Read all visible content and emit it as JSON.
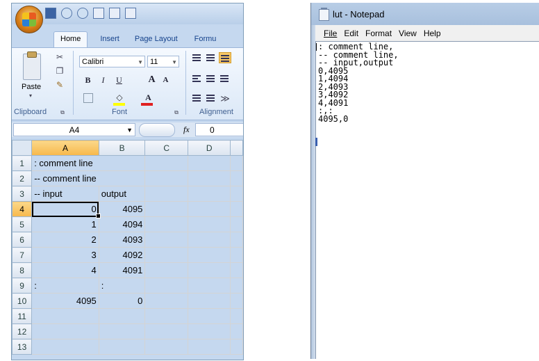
{
  "excel": {
    "tabs": [
      "Home",
      "Insert",
      "Page Layout",
      "Formu"
    ],
    "ribbon": {
      "paste_label": "Paste",
      "font_name": "Calibri",
      "font_size": "11",
      "bold": "B",
      "italic": "I",
      "underline": "U",
      "grow_font": "A",
      "shrink_font": "A",
      "font_color": "A",
      "group_clipboard": "Clipboard",
      "group_font": "Font",
      "group_alignment": "Alignment"
    },
    "name_box": "A4",
    "fx_label": "fx",
    "formula_value": "0",
    "columns": [
      "A",
      "B",
      "C",
      "D"
    ],
    "rows": [
      {
        "n": "1",
        "a": ": comment line",
        "b": ""
      },
      {
        "n": "2",
        "a": "-- comment line",
        "b": ""
      },
      {
        "n": "3",
        "a": "-- input",
        "b": "output"
      },
      {
        "n": "4",
        "a": "0",
        "b": "4095"
      },
      {
        "n": "5",
        "a": "1",
        "b": "4094"
      },
      {
        "n": "6",
        "a": "2",
        "b": "4093"
      },
      {
        "n": "7",
        "a": "3",
        "b": "4092"
      },
      {
        "n": "8",
        "a": "4",
        "b": "4091"
      },
      {
        "n": "9",
        "a": ":",
        "b": ":"
      },
      {
        "n": "10",
        "a": "4095",
        "b": "0"
      },
      {
        "n": "11",
        "a": "",
        "b": ""
      },
      {
        "n": "12",
        "a": "",
        "b": ""
      },
      {
        "n": "13",
        "a": "",
        "b": ""
      }
    ],
    "accent_color": "#f7b84b"
  },
  "notepad": {
    "title": "lut - Notepad",
    "menus": [
      "File",
      "Edit",
      "Format",
      "View",
      "Help"
    ],
    "lines": [
      ": comment line,",
      "-- comment line,",
      "-- input,output",
      "0,4095",
      "1,4094",
      "2,4093",
      "3,4092",
      "4,4091",
      ":,:",
      "4095,0"
    ]
  }
}
